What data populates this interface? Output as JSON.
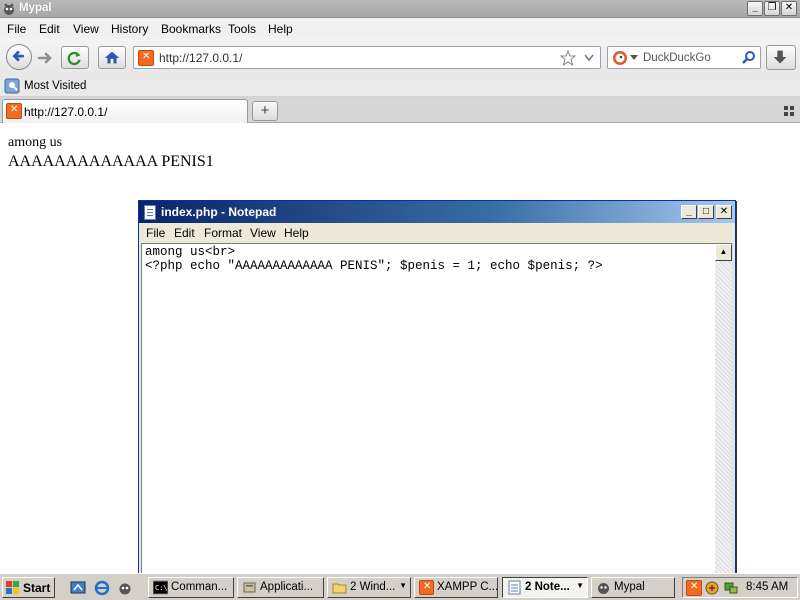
{
  "browser": {
    "window_title": "Mypal",
    "menu": [
      "File",
      "Edit",
      "View",
      "History",
      "Bookmarks",
      "Tools",
      "Help"
    ],
    "url": "http://127.0.0.1/",
    "search_placeholder": "DuckDuckGo",
    "bookmarks": [
      {
        "label": "Most Visited"
      }
    ],
    "tabs": [
      {
        "label": "http://127.0.0.1/"
      }
    ],
    "icons": {
      "back": "arrow-left-icon",
      "forward": "arrow-right-icon",
      "reload": "reload-icon",
      "home": "home-icon",
      "bookmark_star": "star-icon",
      "dropdown": "chevron-down-icon",
      "search": "magnifier-icon",
      "downloads": "download-arrow-icon",
      "new_tab": "plus-icon"
    }
  },
  "page": {
    "line1": "among us",
    "line2": "AAAAAAAAAAAAA PENIS1"
  },
  "notepad": {
    "title": "index.php - Notepad",
    "menu": [
      "File",
      "Edit",
      "Format",
      "View",
      "Help"
    ],
    "lines": [
      "among us<br>",
      "<?php echo \"AAAAAAAAAAAAA PENIS\"; $penis = 1; echo $penis; ?>"
    ]
  },
  "taskbar": {
    "start_label": "Start",
    "tasks": [
      {
        "label": "Comman..."
      },
      {
        "label": "Applicati..."
      },
      {
        "label": "2 Wind..."
      },
      {
        "label": "XAMPP C..."
      },
      {
        "label": "2 Note..."
      },
      {
        "label": "Mypal"
      }
    ],
    "clock": "8:45 AM"
  },
  "colors": {
    "xampp_orange": "#f26b22",
    "notepad_title_start": "#0a246a",
    "notepad_title_end": "#a6caf0",
    "taskbar_gray": "#d4d0c8"
  }
}
